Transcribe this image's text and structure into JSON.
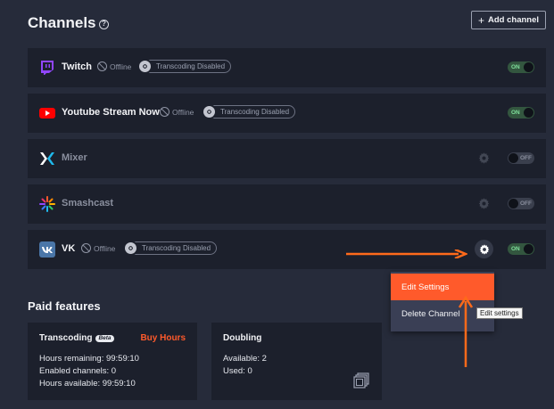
{
  "header": {
    "title": "Channels",
    "help_icon": "?",
    "add_channel_label": "Add channel",
    "add_icon": "+"
  },
  "channels": [
    {
      "name": "Twitch",
      "status": "Offline",
      "transcoding": "Transcoding Disabled",
      "toggle": "ON",
      "logo": "twitch-icon",
      "color": "#9146ff"
    },
    {
      "name": "Youtube Stream Now",
      "status": "Offline",
      "transcoding": "Transcoding Disabled",
      "toggle": "ON",
      "logo": "youtube-icon",
      "color": "#ff0000"
    },
    {
      "name": "Mixer",
      "toggle": "OFF",
      "logo": "mixer-icon",
      "color": "#1fbaed"
    },
    {
      "name": "Smashcast",
      "toggle": "OFF",
      "logo": "smashcast-icon",
      "color": "#ff5a2b"
    },
    {
      "name": "VK",
      "status": "Offline",
      "transcoding": "Transcoding Disabled",
      "toggle": "ON",
      "logo": "vk-icon",
      "color": "#4a76a8"
    }
  ],
  "channel_menu": {
    "edit_label": "Edit Settings",
    "delete_label": "Delete Channel",
    "tooltip": "Edit settings"
  },
  "paid_features": {
    "title": "Paid features",
    "transcoding": {
      "title": "Transcoding",
      "badge": "Beta",
      "buy_label": "Buy Hours",
      "hours_remaining": "Hours remaining: 99:59:10",
      "enabled_channels": "Enabled channels: 0",
      "hours_available": "Hours available: 99:59:10"
    },
    "doubling": {
      "title": "Doubling",
      "available": "Available: 2",
      "used": "Used: 0"
    }
  },
  "colors": {
    "background": "#262b3a",
    "row": "#1c202c",
    "accent": "#ff5a2b",
    "toggle_on": "#7fe09b"
  }
}
